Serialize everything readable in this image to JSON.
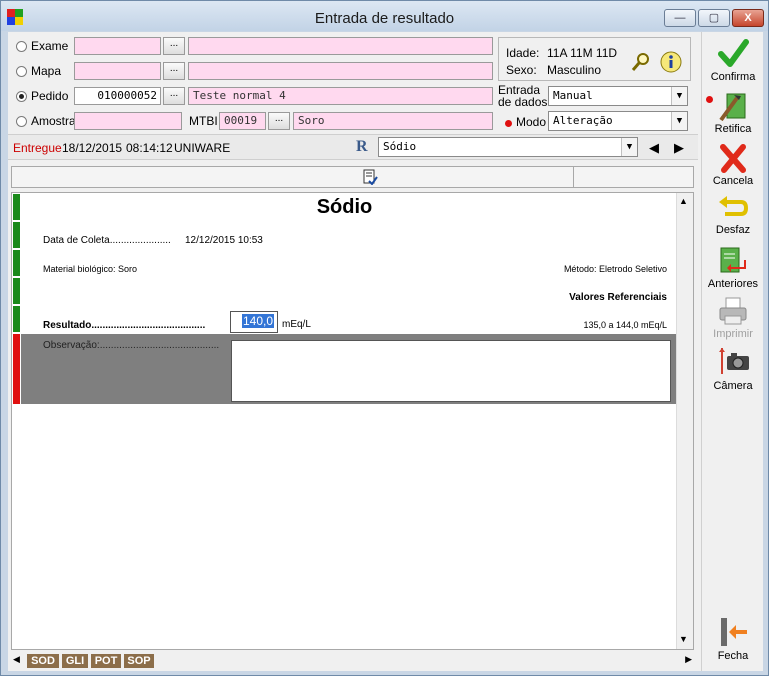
{
  "window": {
    "title": "Entrada de resultado",
    "minimize_label": "—",
    "maximize_label": "▢",
    "close_label": "X"
  },
  "form": {
    "exame_label": "Exame",
    "mapa_label": "Mapa",
    "pedido_label": "Pedido",
    "amostra_label": "Amostra",
    "mtbi_label": "MTBI",
    "pedido_code": "010000052",
    "pedido_desc": "Teste normal 4",
    "mtbi_code": "00019",
    "mtbi_desc": "Soro",
    "dots": "...",
    "selected_option": "Pedido"
  },
  "patient": {
    "idade_label": "Idade:",
    "idade_value": "11A 11M 11D",
    "sexo_label": "Sexo:",
    "sexo_value": "Masculino"
  },
  "entrada": {
    "label_line1": "Entrada",
    "label_line2": "de dados",
    "value": "Manual",
    "modo_label": "Modo",
    "modo_value": "Alteração"
  },
  "status": {
    "state": "Entregue",
    "date": "18/12/2015",
    "time": "08:14:12",
    "user": "UNIWARE",
    "r_icon": "R",
    "exam_select": "Sódio"
  },
  "sheet": {
    "title": "Sódio",
    "coleta_label": "Data de Coleta......................",
    "coleta_value": "12/12/2015 10:53",
    "material_label": "Material biológico: Soro",
    "metodo_label": "Método: Eletrodo Seletivo",
    "valores_ref_label": "Valores Referenciais",
    "resultado_label": "Resultado.........................................",
    "resultado_value": "140,0",
    "resultado_unit": "mEq/L",
    "ref_range": "135,0 a 144,0 mEq/L",
    "observacao_label": "Observação:...........................................",
    "observacao_value": ""
  },
  "panel_tabs": [
    "SOD",
    "GLI",
    "POT",
    "SOP"
  ],
  "sidebar": {
    "confirma": "Confirma",
    "retifica": "Retifica",
    "cancela": "Cancela",
    "desfaz": "Desfaz",
    "anteriores": "Anteriores",
    "imprimir": "Imprimir",
    "camera": "Câmera",
    "fecha": "Fecha"
  },
  "colors": {
    "green_bar": "#1a8a1a",
    "red_bar": "#e01010",
    "pink_field": "#ffd9ef",
    "status_red": "#cc0000"
  }
}
